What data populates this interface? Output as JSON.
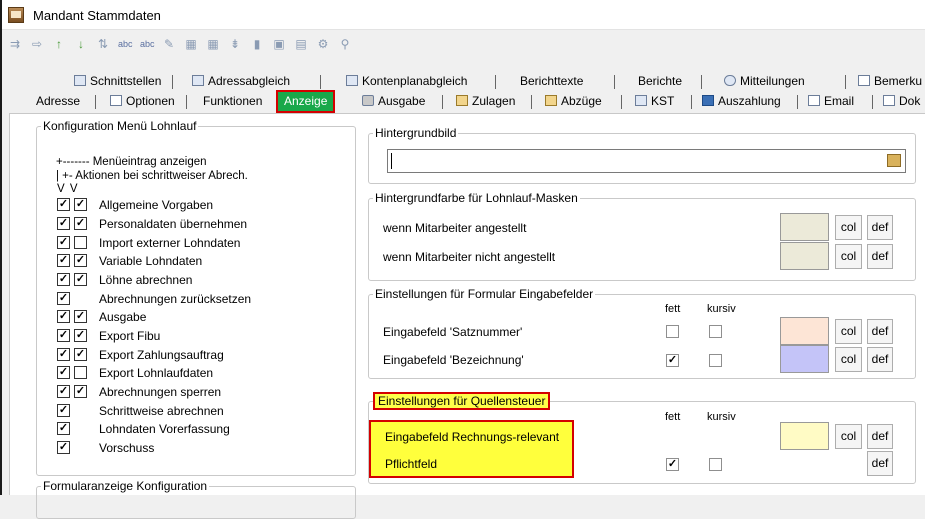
{
  "window": {
    "title": "Mandant Stammdaten"
  },
  "toolbar": {
    "icons": [
      "align-icon",
      "insert-icon",
      "up-icon",
      "down-icon",
      "sort-icon",
      "spell-icon",
      "spell2-icon",
      "edit-icon",
      "grid-icon",
      "grid2-icon",
      "filter-icon",
      "book-icon",
      "save-icon",
      "doc-icon",
      "settings-icon",
      "search-icon"
    ]
  },
  "tabs_top": [
    "Schnittstellen",
    "Adressabgleich",
    "Kontenplanabgleich",
    "Berichttexte",
    "Berichte",
    "Mitteilungen",
    "Bemerku"
  ],
  "tabs_bottom": [
    "Adresse",
    "Optionen",
    "Funktionen",
    "Anzeige",
    "Ausgabe",
    "Zulagen",
    "Abzüge",
    "KST",
    "Auszahlung",
    "Email",
    "Dok"
  ],
  "left_group": {
    "title": "Konfiguration Menü Lohnlauf",
    "legend_line1": "+------- Menüeintrag anzeigen",
    "legend_line2": "|    +- Aktionen bei schrittweiser Abrech.",
    "legend_vv": "V  V",
    "items": [
      {
        "label": "Allgemeine Vorgaben",
        "c1": "✓",
        "c2": "✓"
      },
      {
        "label": "Personaldaten übernehmen",
        "c1": "✓",
        "c2": "✓"
      },
      {
        "label": "Import externer Lohndaten",
        "c1": "✓",
        "c2": ""
      },
      {
        "label": "Variable Lohndaten",
        "c1": "✓",
        "c2": "✓"
      },
      {
        "label": "Löhne abrechnen",
        "c1": "✓",
        "c2": "✓"
      },
      {
        "label": "Abrechnungen zurücksetzen",
        "c1": "✓",
        "c2": null
      },
      {
        "label": "Ausgabe",
        "c1": "✓",
        "c2": "✓"
      },
      {
        "label": "Export Fibu",
        "c1": "✓",
        "c2": "✓"
      },
      {
        "label": "Export Zahlungsauftrag",
        "c1": "✓",
        "c2": "✓"
      },
      {
        "label": "Export Lohnlaufdaten",
        "c1": "✓",
        "c2": ""
      },
      {
        "label": "Abrechnungen sperren",
        "c1": "✓",
        "c2": "✓"
      },
      {
        "label": "Schrittweise abrechnen",
        "c1": "✓",
        "c2": null
      },
      {
        "label": "Lohndaten Vorerfassung",
        "c1": "✓",
        "c2": null
      },
      {
        "label": "Vorschuss",
        "c1": "✓",
        "c2": null
      }
    ]
  },
  "left_group2": {
    "title": "Formularanzeige Konfiguration"
  },
  "hintergrundbild": {
    "title": "Hintergrundbild",
    "value": ""
  },
  "hintergrundfarbe": {
    "title": "Hintergrundfarbe für Lohnlauf-Masken",
    "rows": [
      {
        "label": "wenn Mitarbeiter angestellt",
        "color": "#ecead9"
      },
      {
        "label": "wenn Mitarbeiter nicht angestellt",
        "color": "#ecead9"
      }
    ]
  },
  "formular": {
    "title": "Einstellungen für Formular Eingabefelder",
    "col_fett": "fett",
    "col_kursiv": "kursiv",
    "rows": [
      {
        "label": "Eingabefeld 'Satznummer'",
        "fett": "",
        "kursiv": "",
        "color": "#fde5d6"
      },
      {
        "label": "Eingabefeld 'Bezeichnung'",
        "fett": "✓",
        "kursiv": "",
        "color": "#c4c4f8"
      }
    ]
  },
  "quellensteuer": {
    "title": "Einstellungen für Quellensteuer",
    "col_fett": "fett",
    "col_kursiv": "kursiv",
    "rows": [
      {
        "label": "Eingabefeld Rechnungs-relevant",
        "color": "#fffbc5"
      },
      {
        "label": "Pflichtfeld",
        "fett": "✓",
        "kursiv": ""
      }
    ]
  },
  "buttons": {
    "col": "col",
    "def": "def"
  }
}
